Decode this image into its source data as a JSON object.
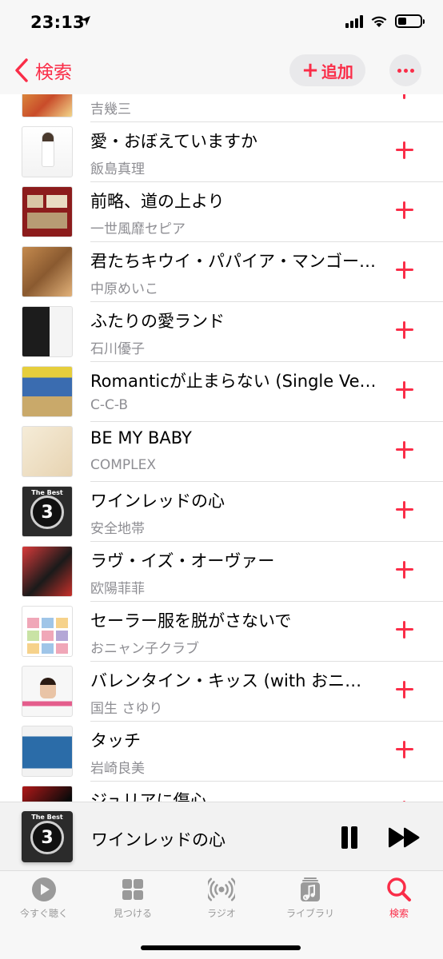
{
  "status_bar": {
    "time": "23:13",
    "location_icon": "location-arrow-icon",
    "icons": [
      "cellular-signal-icon",
      "wifi-icon",
      "battery-icon"
    ]
  },
  "nav": {
    "back_label": "検索",
    "add_label": "追加",
    "more_icon": "ellipsis-icon"
  },
  "colors": {
    "accent": "#fa2d48",
    "secondary_text": "#8e8e93"
  },
  "songs": [
    {
      "title": "",
      "artist": "吉幾三",
      "art": "album-art"
    },
    {
      "title": "愛・おぼえていますか",
      "artist": "飯島真理",
      "art": "album-art"
    },
    {
      "title": "前略、道の上より",
      "artist": "一世風靡セピア",
      "art": "album-art"
    },
    {
      "title": "君たちキウイ・パパイア・マンゴーだね。",
      "artist": "中原めいこ",
      "art": "album-art"
    },
    {
      "title": "ふたりの愛ランド",
      "artist": "石川優子",
      "art": "album-art"
    },
    {
      "title": "Romanticが止まらない (Single Version)",
      "artist": "C-C-B",
      "art": "album-art"
    },
    {
      "title": "BE MY BABY",
      "artist": "COMPLEX",
      "art": "album-art"
    },
    {
      "title": "ワインレッドの心",
      "artist": "安全地帯",
      "art": "album-art"
    },
    {
      "title": "ラヴ・イズ・オーヴァー",
      "artist": "欧陽菲菲",
      "art": "album-art"
    },
    {
      "title": "セーラー服を脱がさないで",
      "artist": "おニャン子クラブ",
      "art": "album-art"
    },
    {
      "title": "バレンタイン・キッス (with おニャン子クラブ)",
      "artist": "国生 さゆり",
      "art": "album-art"
    },
    {
      "title": "タッチ",
      "artist": "岩崎良美",
      "art": "album-art"
    },
    {
      "title": "ジュリアに傷心",
      "artist": "",
      "art": "album-art"
    }
  ],
  "now_playing": {
    "title": "ワインレッドの心",
    "art_text": "The Best",
    "art_number": "3",
    "pause_icon": "pause-icon",
    "forward_icon": "fast-forward-icon"
  },
  "tabs": [
    {
      "label": "今すぐ聴く",
      "icon": "play-circle-icon",
      "active": false
    },
    {
      "label": "見つける",
      "icon": "grid-icon",
      "active": false
    },
    {
      "label": "ラジオ",
      "icon": "radio-waves-icon",
      "active": false
    },
    {
      "label": "ライブラリ",
      "icon": "music-library-icon",
      "active": false
    },
    {
      "label": "検索",
      "icon": "search-icon",
      "active": true
    }
  ]
}
